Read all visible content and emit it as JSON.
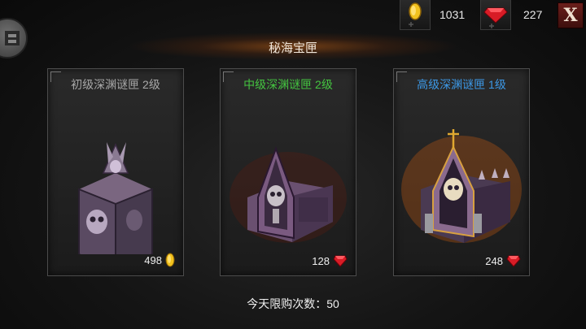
{
  "resources": {
    "gold": {
      "value": "1031",
      "icon": "gold-coin-icon",
      "color": "#f0c020"
    },
    "ruby": {
      "value": "227",
      "icon": "ruby-gem-icon",
      "color": "#e0202a"
    }
  },
  "close_label": "X",
  "title": "秘海宝匣",
  "cards": [
    {
      "name": "初级深渊谜匣 2级",
      "name_color": "#a8a8a8",
      "price": "498",
      "currency": "gold"
    },
    {
      "name": "中级深渊谜匣 2级",
      "name_color": "#44c540",
      "price": "128",
      "currency": "ruby"
    },
    {
      "name": "高级深渊谜匣 1级",
      "name_color": "#3c98e6",
      "price": "248",
      "currency": "ruby"
    }
  ],
  "daily_limit": "今天限购次数：50"
}
